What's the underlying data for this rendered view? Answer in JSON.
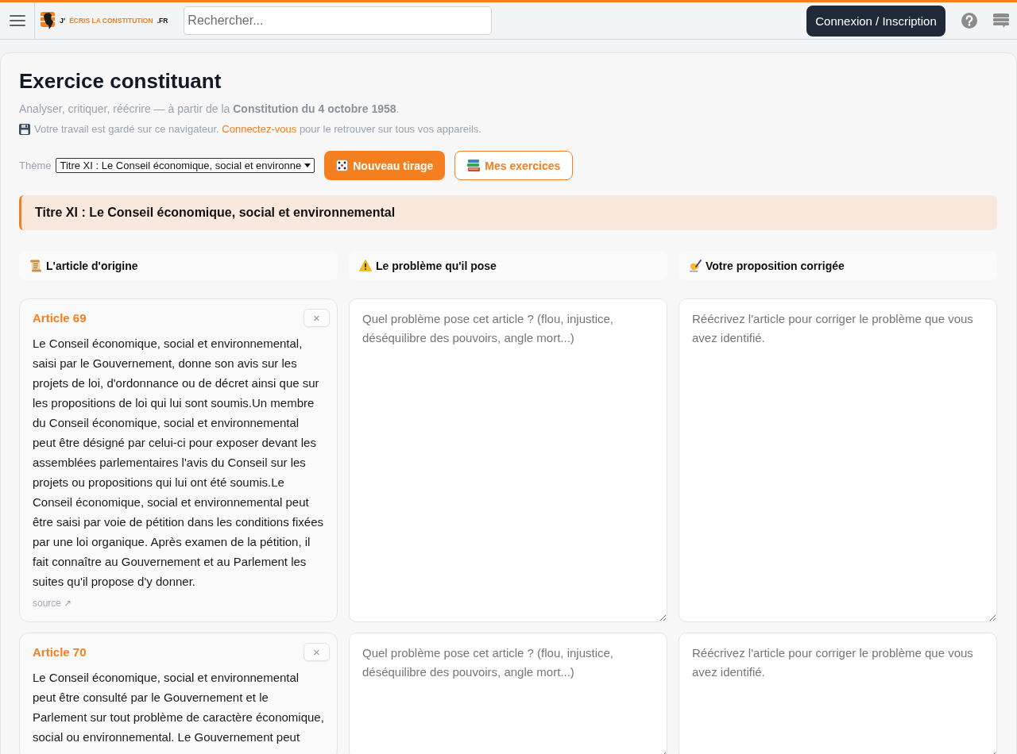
{
  "header": {
    "logo": {
      "prefix": "J'",
      "name": "ÉCRIS LA CONSTITUTION",
      "suffix": ".FR"
    },
    "search": {
      "placeholder": "Rechercher..."
    },
    "login_button": "Connexion / Inscription"
  },
  "page": {
    "title": "Exercice constituant",
    "subtitle": "Analyser, critiquer, réécrire — à partir de la **Constitution du 4 octobre 1958**.",
    "save_note": {
      "before": "Votre travail est gardé sur ce navigateur. ",
      "link": "Connectez-vous",
      "after": " pour le retrouver sur tous vos appareils."
    }
  },
  "theme": {
    "label": "Thème",
    "value": "Titre XI : Le Conseil économique, social et environne"
  },
  "buttons": [
    {
      "kind": "primary",
      "label": "Nouveau tirage"
    },
    {
      "kind": "secondary",
      "label": "Mes exercices"
    }
  ],
  "section_title": "Titre XI : Le Conseil économique, social et environnemental",
  "columns": [
    {
      "kind": "original",
      "label": "L'article d'origine"
    },
    {
      "kind": "problem",
      "label": "Le problème qu'il pose"
    },
    {
      "kind": "proposal",
      "label": "Votre proposition corrigée"
    }
  ],
  "exercises": [
    {
      "article": "Article 69",
      "close": "×",
      "text": "Le Conseil économique, social et environnemental, saisi par le Gouvernement, donne son avis sur les projets de loi, d'ordonnance ou de décret ainsi que sur les propositions de loi qui lui sont soumis.Un membre du Conseil économique, social et environnemental peut être désigné par celui-ci pour exposer devant les assemblées parlementaires l'avis du Conseil sur les projets ou propositions qui lui ont été soumis.Le Conseil économique, social et environnemental peut être saisi par voie de pétition dans les conditions fixées par une loi organique. Après examen de la pétition, il fait connaître au Gouvernement et au Parlement les suites qu'il propose d'y donner.",
      "source": "source ↗",
      "problem": {
        "placeholder": "Quel problème pose cet article ? (flou, injustice, déséquilibre des pouvoirs, angle mort...)"
      },
      "proposal": {
        "placeholder": "Réécrivez l'article pour corriger le problème que vous avez identifié."
      }
    },
    {
      "article": "Article 70",
      "close": "×",
      "text": "Le Conseil économique, social et environnemental peut être consulté par le Gouvernement et le Parlement sur tout problème de caractère économique, social ou environnemental. Le Gouvernement peut",
      "problem": {
        "placeholder": "Quel problème pose cet article ? (flou, injustice, déséquilibre des pouvoirs, angle mort...)"
      },
      "proposal": {
        "placeholder": "Réécrivez l'article pour corriger le problème que vous avez identifié."
      }
    }
  ]
}
